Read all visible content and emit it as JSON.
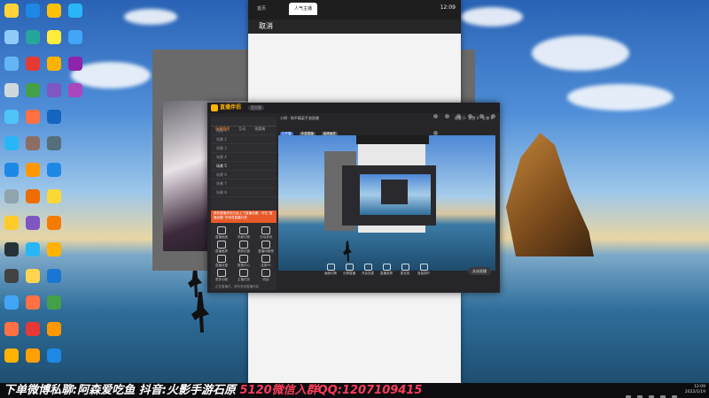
{
  "desktop": {
    "icons": [
      {
        "col": 0,
        "row": 0,
        "color": "#ffd23a"
      },
      {
        "col": 1,
        "row": 0,
        "color": "#1e88e5"
      },
      {
        "col": 2,
        "row": 0,
        "color": "#ffc107"
      },
      {
        "col": 3,
        "row": 0,
        "color": "#29b6f6"
      },
      {
        "col": 0,
        "row": 1,
        "color": "#90caf9"
      },
      {
        "col": 1,
        "row": 1,
        "color": "#26a69a"
      },
      {
        "col": 2,
        "row": 1,
        "color": "#ffeb3b"
      },
      {
        "col": 3,
        "row": 1,
        "color": "#42a5f5"
      },
      {
        "col": 0,
        "row": 2,
        "color": "#64b5f6"
      },
      {
        "col": 1,
        "row": 2,
        "color": "#e53935"
      },
      {
        "col": 2,
        "row": 2,
        "color": "#ffb300"
      },
      {
        "col": 3,
        "row": 2,
        "color": "#8e24aa"
      },
      {
        "col": 0,
        "row": 3,
        "color": "#cfd8dc"
      },
      {
        "col": 1,
        "row": 3,
        "color": "#43a047"
      },
      {
        "col": 2,
        "row": 3,
        "color": "#7e57c2"
      },
      {
        "col": 3,
        "row": 3,
        "color": "#ab47bc"
      },
      {
        "col": 0,
        "row": 4,
        "color": "#4fc3f7"
      },
      {
        "col": 1,
        "row": 4,
        "color": "#ff7043"
      },
      {
        "col": 2,
        "row": 4,
        "color": "#1565c0"
      },
      {
        "col": 0,
        "row": 5,
        "color": "#29b6f6"
      },
      {
        "col": 1,
        "row": 5,
        "color": "#8d6e63"
      },
      {
        "col": 2,
        "row": 5,
        "color": "#546e7a"
      },
      {
        "col": 0,
        "row": 6,
        "color": "#1e88e5"
      },
      {
        "col": 1,
        "row": 6,
        "color": "#ff9800"
      },
      {
        "col": 2,
        "row": 6,
        "color": "#1e88e5"
      },
      {
        "col": 0,
        "row": 7,
        "color": "#90a4ae"
      },
      {
        "col": 1,
        "row": 7,
        "color": "#ef6c00"
      },
      {
        "col": 2,
        "row": 7,
        "color": "#fdd835"
      },
      {
        "col": 0,
        "row": 8,
        "color": "#ffca28"
      },
      {
        "col": 1,
        "row": 8,
        "color": "#7e57c2"
      },
      {
        "col": 2,
        "row": 8,
        "color": "#f57c00"
      },
      {
        "col": 0,
        "row": 9,
        "color": "#263238"
      },
      {
        "col": 1,
        "row": 9,
        "color": "#29b6f6"
      },
      {
        "col": 2,
        "row": 9,
        "color": "#ffb300"
      },
      {
        "col": 0,
        "row": 10,
        "color": "#424242"
      },
      {
        "col": 1,
        "row": 10,
        "color": "#ffd54f"
      },
      {
        "col": 2,
        "row": 10,
        "color": "#1976d2"
      },
      {
        "col": 0,
        "row": 11,
        "color": "#42a5f5"
      },
      {
        "col": 1,
        "row": 11,
        "color": "#ff7043"
      },
      {
        "col": 2,
        "row": 11,
        "color": "#43a047"
      },
      {
        "col": 0,
        "row": 12,
        "color": "#ff7043"
      },
      {
        "col": 1,
        "row": 12,
        "color": "#e53935"
      },
      {
        "col": 2,
        "row": 12,
        "color": "#ff9800"
      },
      {
        "col": 0,
        "row": 13,
        "color": "#ffb300"
      },
      {
        "col": 1,
        "row": 13,
        "color": "#ffa000"
      },
      {
        "col": 2,
        "row": 13,
        "color": "#1e88e5"
      }
    ]
  },
  "phone": {
    "tabs": [
      "首页",
      "人气主播"
    ],
    "clock": "12:09",
    "cancel": "取消"
  },
  "live": {
    "brand": "直播伴侣",
    "version": "官方版",
    "tabs": [
      "场景管理",
      "互动",
      "观看端"
    ],
    "scenes": [
      "场景 1",
      "场景 2",
      "场景 3",
      "场景 4",
      "场景 5",
      "场景 6",
      "场景 7",
      "场景 8"
    ],
    "banner": "新的直播伴侣已经上了直播设置，可在“直播设置”中修改直播分类",
    "tools": [
      {
        "label": "直播画面",
        "col": 0,
        "row": 0
      },
      {
        "label": "场景切换",
        "col": 1,
        "row": 0
      },
      {
        "label": "互动游戏",
        "col": 2,
        "row": 0
      },
      {
        "label": "直播截屏",
        "col": 0,
        "row": 1
      },
      {
        "label": "美颜设置",
        "col": 1,
        "row": 1
      },
      {
        "label": "直播间管理",
        "col": 2,
        "row": 1
      },
      {
        "label": "直播设置",
        "col": 0,
        "row": 2
      },
      {
        "label": "数据中心",
        "col": 1,
        "row": 2
      },
      {
        "label": "连麦PK",
        "col": 2,
        "row": 2
      },
      {
        "label": "更多功能",
        "col": 0,
        "row": 3
      },
      {
        "label": "主播任务",
        "col": 1,
        "row": 3
      },
      {
        "label": "收起",
        "col": 2,
        "row": 3
      }
    ],
    "footer": "正在直播中，请勿关闭直播伴侣",
    "info_title": "小明 · 和平精英手游直播",
    "pills": [
      "已开播",
      "手游直播",
      "高清画质"
    ],
    "stats": "观看 0 · 点赞 0 · 礼物 0",
    "bottom_buttons": [
      "画面切换",
      "分屏直播",
      "开启连麦",
      "直播录屏",
      "麦克风",
      "音量调节"
    ],
    "start": "关闭直播"
  },
  "taskbar": {
    "marquee_a": "下单微博私聊:",
    "marquee_b": "阿森爱吃鱼",
    "marquee_c": "  抖音:火影手游石原  ",
    "marquee_d": "5120微信入群QQ:1207109415",
    "time": "12:09",
    "date": "2022/1/19"
  }
}
